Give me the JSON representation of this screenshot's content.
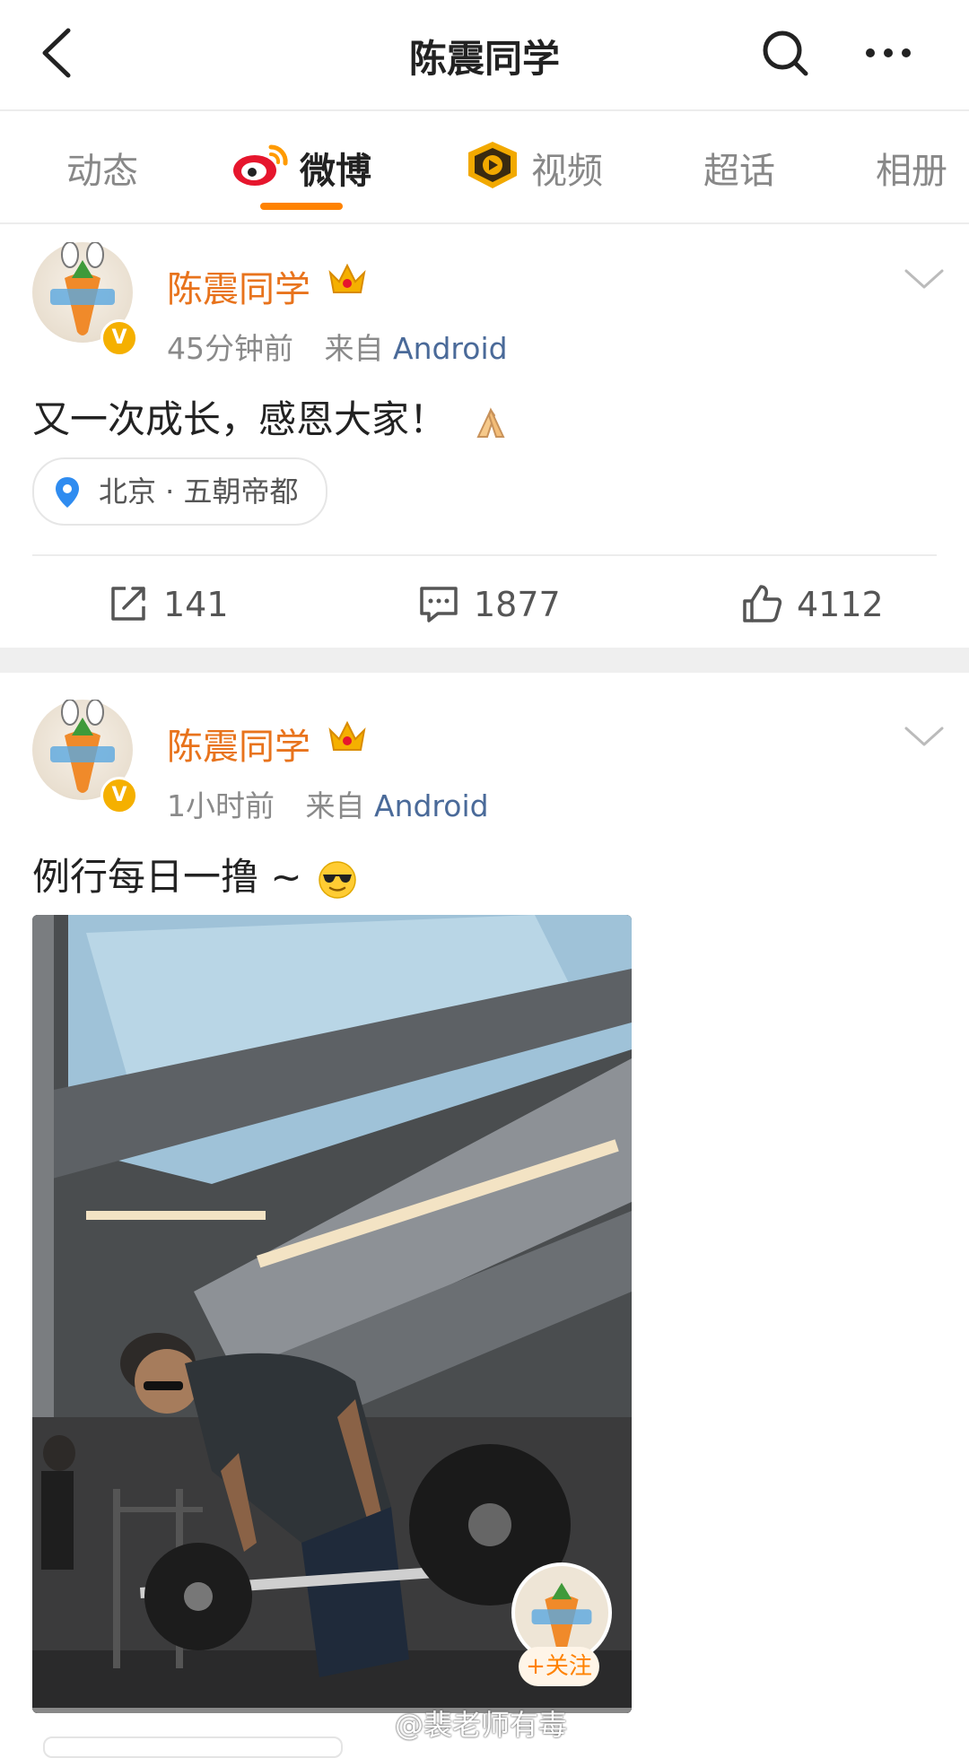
{
  "header": {
    "title": "陈震同学",
    "back_icon": "chevron-left-icon",
    "search_icon": "search-icon",
    "more_icon": "more-dots-icon"
  },
  "tabs": [
    {
      "label": "动态",
      "active": false
    },
    {
      "label": "微博",
      "active": true,
      "icon": "weibo-logo-icon"
    },
    {
      "label": "视频",
      "active": false,
      "icon": "video-badge-icon"
    },
    {
      "label": "超话",
      "active": false
    },
    {
      "label": "相册",
      "active": false
    }
  ],
  "colors": {
    "accent": "#ff8200",
    "username": "#e8731c",
    "source": "#4a6a99",
    "verified": "#f5b000"
  },
  "posts": [
    {
      "username": "陈震同学",
      "time": "45分钟前",
      "source_prefix": "来自",
      "source": "Android",
      "text": "又一次成长，感恩大家！",
      "emoji": "folded-hands-emoji",
      "location": "北京 · 五朝帝都",
      "reposts": "141",
      "comments": "1877",
      "likes": "4112"
    },
    {
      "username": "陈震同学",
      "time": "1小时前",
      "source_prefix": "来自",
      "source": "Android",
      "text": "例行每日一撸 ~",
      "emoji": "sunglasses-emoji",
      "video_follow_label": "+关注",
      "watermark": "@裴老师有毒"
    }
  ]
}
